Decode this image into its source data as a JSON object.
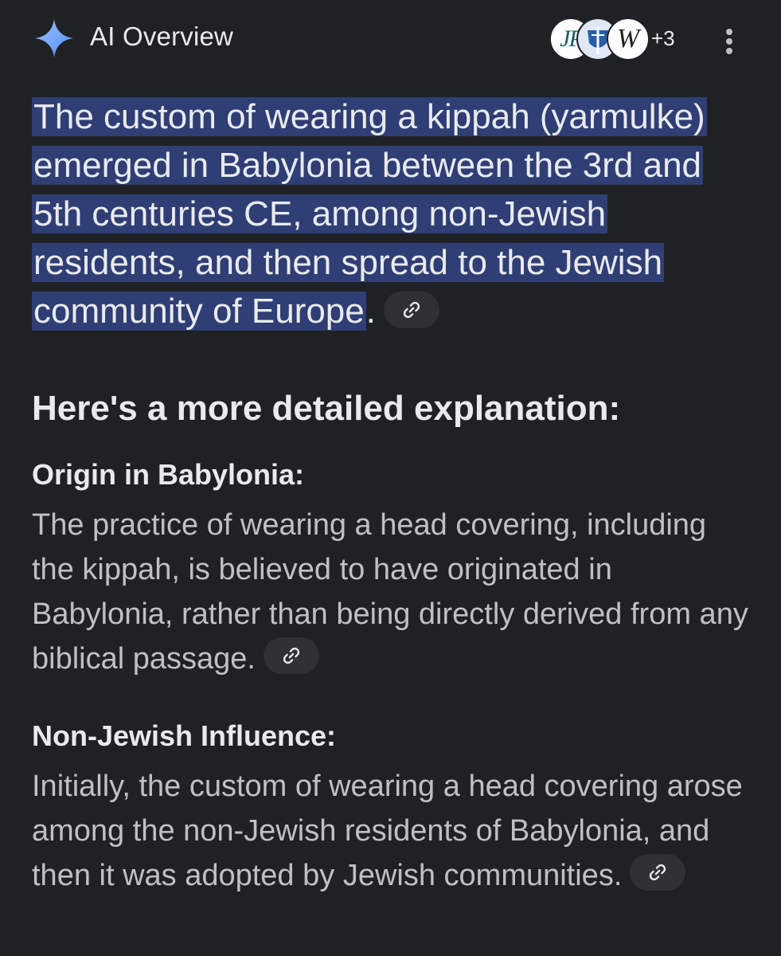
{
  "header": {
    "title": "AI Overview",
    "sources": [
      {
        "label": "JP",
        "icon": "jp-source-icon"
      },
      {
        "label": "",
        "icon": "crest-source-icon"
      },
      {
        "label": "W",
        "icon": "wikipedia-source-icon"
      }
    ],
    "more_sources": "+3",
    "menu_icon": "more-vert-icon"
  },
  "summary": {
    "highlighted_text": "The custom of wearing a kippah (yarmulke) emerged in Babylonia between the 3rd and 5th centuries CE, among non-Jewish residents, and then spread to the Jewish community of Europe",
    "trailing": ".",
    "link_icon": "link-icon"
  },
  "details": {
    "heading": "Here's a more detailed explanation:",
    "items": [
      {
        "title": "Origin in Babylonia:",
        "text": "The practice of wearing a head covering, including the kippah, is believed to have originated in Babylonia, rather than being directly derived from any biblical passage."
      },
      {
        "title": "Non-Jewish Influence:",
        "text": "Initially, the custom of wearing a head covering arose among the non-Jewish residents of Babylonia, and then it was adopted by Jewish communities."
      }
    ]
  },
  "colors": {
    "background": "#202124",
    "highlight": "#2f3e74",
    "sparkle": "#8ab4f8",
    "chip": "#303134"
  }
}
